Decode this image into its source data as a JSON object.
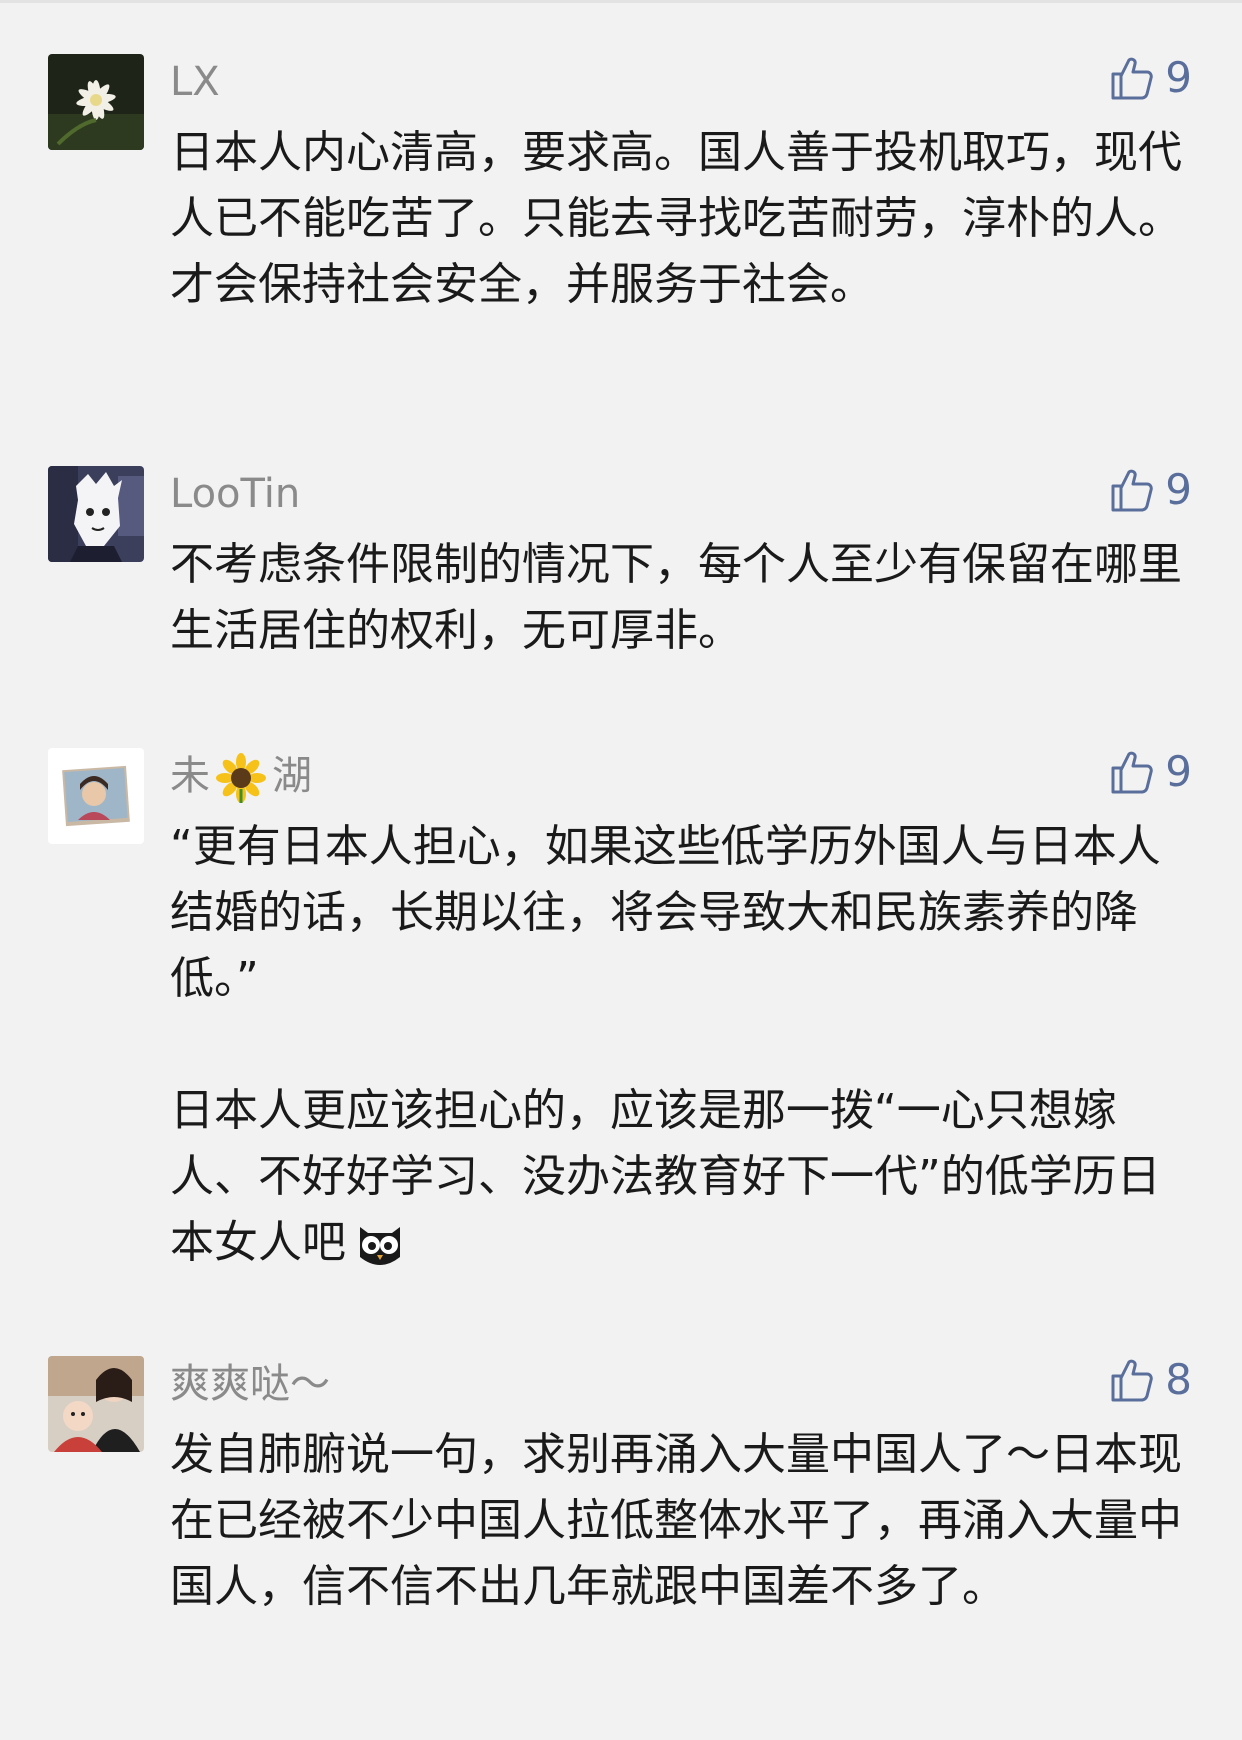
{
  "comments": [
    {
      "author": "LX",
      "likes": "9",
      "avatar_icon": "night-flower-avatar",
      "paragraphs": [
        "日本人内心清高，要求高。国人善于投机取巧，现代人已不能吃苦了。只能去寻找吃苦耐劳，淳朴的人。才会保持社会安全，并服务于社会。"
      ]
    },
    {
      "author": "LooTin",
      "likes": "9",
      "avatar_icon": "anime-character-avatar",
      "paragraphs": [
        "不考虑条件限制的情况下，每个人至少有保留在哪里生活居住的权利，无可厚非。"
      ]
    },
    {
      "author_prefix": "未",
      "author_suffix": "湖",
      "author_emoji": "sunflower-emoji",
      "likes": "9",
      "avatar_icon": "photo-woman-avatar",
      "paragraphs": [
        "“更有日本人担心，如果这些低学历外国人与日本人结婚的话，长期以往，将会导致大和民族素养的降低。”",
        "日本人更应该担心的，应该是那一拨“一心只想嫁人、不好好学习、没办法教育好下一代”的低学历日本女人吧"
      ],
      "trailing_emoji": "owl-emoji"
    },
    {
      "author": "爽爽哒～",
      "likes": "8",
      "avatar_icon": "mother-child-avatar",
      "paragraphs": [
        "发自肺腑说一句，求别再涌入大量中国人了～日本现在已经被不少中国人拉低整体水平了，再涌入大量中国人，信不信不出几年就跟中国差不多了。"
      ]
    }
  ],
  "colors": {
    "background": "#f2f2f2",
    "author": "#8a8a8a",
    "like": "#5a6e9c",
    "text": "#1a1a1a"
  }
}
